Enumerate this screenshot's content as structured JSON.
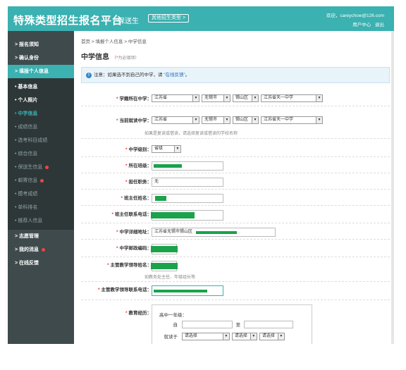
{
  "header": {
    "brand": "特殊类型招生报名平台",
    "role": "保送生",
    "type_button": "其他招生类型 >",
    "welcome": "欢迎，careychow@126.com",
    "user_center": "用户中心",
    "logout": "退出"
  },
  "sidebar": {
    "items": [
      {
        "label": "> 报名须知"
      },
      {
        "label": "> 确认身份"
      },
      {
        "label": "> 填报个人信息"
      }
    ],
    "sub_items": [
      {
        "label": "• 基本信息"
      },
      {
        "label": "• 个人照片"
      },
      {
        "label": "• 中学信息"
      },
      {
        "label": "• 成绩信息"
      },
      {
        "label": "• 选考科目成绩"
      },
      {
        "label": "• 综合信息"
      },
      {
        "label": "• 保送生信息"
      },
      {
        "label": "• 邮寄信息"
      },
      {
        "label": "• 模考成绩"
      },
      {
        "label": "• 单科排名"
      },
      {
        "label": "• 推荐人信息"
      }
    ],
    "bottom_items": [
      {
        "label": "> 志愿管理"
      },
      {
        "label": "> 我的消息"
      },
      {
        "label": "> 在线反馈"
      }
    ]
  },
  "breadcrumb": "首页 > 填报个人信息 > 中学信息",
  "page_title": "中学信息",
  "required_note_star": "（*",
  "required_note_text": "为必填项）",
  "notice": {
    "prefix": "注意：如果选不到自己的中学，请 ",
    "link": "“在线反馈”",
    "suffix": "。"
  },
  "form": {
    "school_location_label": "学籍所在中学：",
    "current_school_label": "当前就读中学：",
    "province": "江苏省",
    "city": "无锡市",
    "district": "锡山区",
    "school": "江苏省天一中学",
    "current_hint": "如果是复读或借读，请选择复读或借读的学校名称",
    "school_level_label": "中学级别：",
    "school_level": "省级",
    "class_label": "所在班级：",
    "duty_label": "担任职务：",
    "duty_value": "无",
    "head_teacher_label": "班主任姓名：",
    "head_teacher_phone_label": "班主任联系电话：",
    "address_label": "中学详细地址：",
    "address_value": "江苏省无锡市锡山区",
    "postcode_label": "中学邮政编码：",
    "leader_name_label": "主管教学领导姓名：",
    "leader_hint": "如教务处主任、年级组长等",
    "leader_phone_label": "主管教学领导联系电话：",
    "education_label": "教育经历：",
    "edu_grade": "高中一年级：",
    "edu_from": "自",
    "edu_to": "至",
    "edu_study_at": "就读于",
    "edu_placeholder": "请选择"
  }
}
